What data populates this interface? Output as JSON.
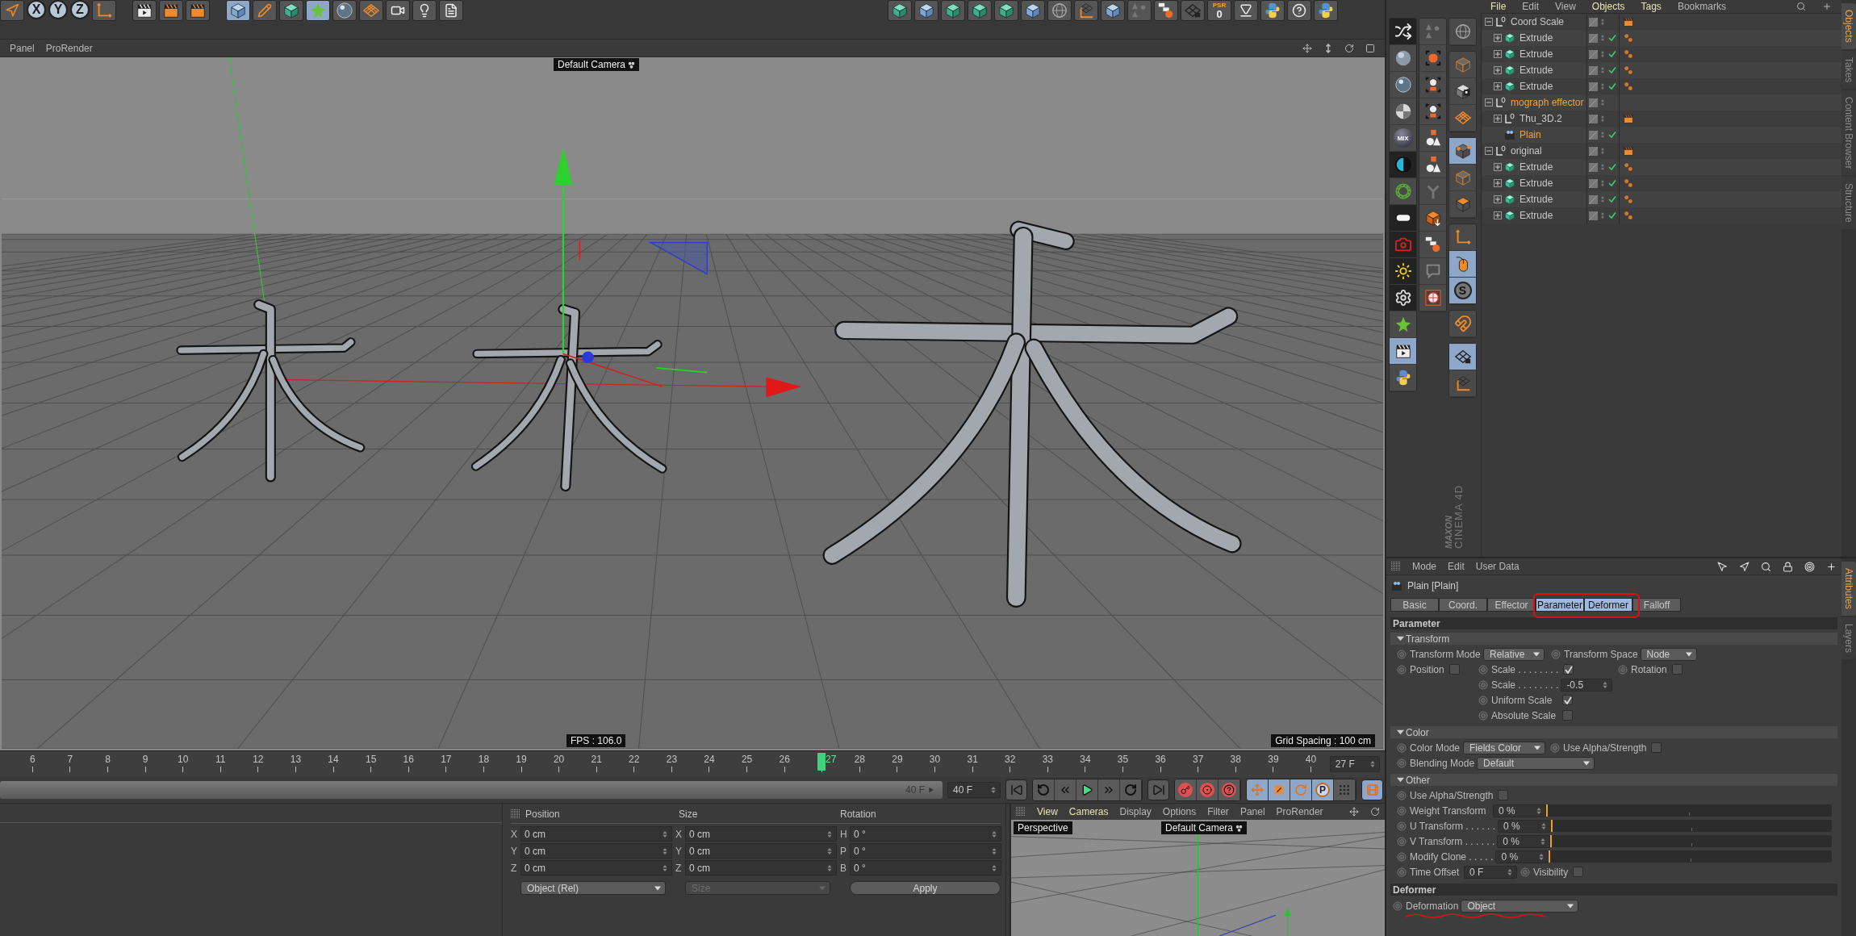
{
  "toolbar": {
    "axis_buttons": [
      {
        "label": "X",
        "selected": true
      },
      {
        "label": "Y",
        "selected": true
      },
      {
        "label": "Z",
        "selected": true
      }
    ],
    "psr_label": "PSR",
    "psr_value": "0"
  },
  "viewport": {
    "menu": [
      "Panel",
      "ProRender"
    ],
    "camera_label": "Default Camera",
    "fps": "FPS : 106.0",
    "grid_spacing": "Grid Spacing : 100 cm"
  },
  "timeline": {
    "ticks": [
      {
        "label": "6",
        "selected": false
      },
      {
        "label": "7",
        "selected": false
      },
      {
        "label": "8",
        "selected": false
      },
      {
        "label": "9",
        "selected": false
      },
      {
        "label": "10",
        "selected": false
      },
      {
        "label": "11",
        "selected": false
      },
      {
        "label": "12",
        "selected": false
      },
      {
        "label": "13",
        "selected": false
      },
      {
        "label": "14",
        "selected": false
      },
      {
        "label": "15",
        "selected": false
      },
      {
        "label": "16",
        "selected": false
      },
      {
        "label": "17",
        "selected": false
      },
      {
        "label": "18",
        "selected": false
      },
      {
        "label": "19",
        "selected": false
      },
      {
        "label": "20",
        "selected": false
      },
      {
        "label": "21",
        "selected": false
      },
      {
        "label": "22",
        "selected": false
      },
      {
        "label": "23",
        "selected": false
      },
      {
        "label": "24",
        "selected": false
      },
      {
        "label": "25",
        "selected": false
      },
      {
        "label": "26",
        "selected": false
      },
      {
        "label": "27",
        "selected": true
      },
      {
        "label": "28",
        "selected": false
      },
      {
        "label": "29",
        "selected": false
      },
      {
        "label": "30",
        "selected": false
      },
      {
        "label": "31",
        "selected": false
      },
      {
        "label": "32",
        "selected": false
      },
      {
        "label": "33",
        "selected": false
      },
      {
        "label": "34",
        "selected": false
      },
      {
        "label": "35",
        "selected": false
      },
      {
        "label": "36",
        "selected": false
      },
      {
        "label": "37",
        "selected": false
      },
      {
        "label": "38",
        "selected": false
      },
      {
        "label": "39",
        "selected": false
      },
      {
        "label": "40",
        "selected": false
      }
    ],
    "current_field": "27 F",
    "range": {
      "end_label": "40 F",
      "level": 1
    },
    "end_field": "40 F",
    "param_label": "P"
  },
  "coordinates": {
    "headers": [
      "Position",
      "Size",
      "Rotation"
    ],
    "rows": [
      {
        "pos_axis": "X",
        "pos": "0 cm",
        "size_axis": "X",
        "size": "0 cm",
        "rot_axis": "H",
        "rot": "0 °"
      },
      {
        "pos_axis": "Y",
        "pos": "0 cm",
        "size_axis": "Y",
        "size": "0 cm",
        "rot_axis": "P",
        "rot": "0 °"
      },
      {
        "pos_axis": "Z",
        "pos": "0 cm",
        "size_axis": "Z",
        "size": "0 cm",
        "rot_axis": "B",
        "rot": "0 °"
      }
    ],
    "mode_dropdown": "Object (Rel)",
    "size_dropdown": {
      "value": "Size",
      "disabled": true
    },
    "apply_button": "Apply"
  },
  "mini_viewport": {
    "menu": [
      {
        "label": "View",
        "highlighted": true
      },
      {
        "label": "Cameras",
        "highlighted": true
      },
      {
        "label": "Display",
        "highlighted": false
      },
      {
        "label": "Options",
        "highlighted": false
      },
      {
        "label": "Filter",
        "highlighted": false
      },
      {
        "label": "Panel",
        "highlighted": false
      },
      {
        "label": "ProRender",
        "highlighted": false
      }
    ],
    "projection_label": "Perspective",
    "camera_label": "Default Camera"
  },
  "palette": {
    "mix_label": "MIX",
    "snap_label": "S",
    "logo_brand": "MAXON",
    "logo_product": "CINEMA 4D"
  },
  "object_manager": {
    "menu": [
      "File",
      "Edit",
      "View",
      "Objects",
      "Tags",
      "Bookmarks"
    ],
    "tree": [
      {
        "name": "Coord Scale",
        "kind": "null",
        "selected": false,
        "expanded": true,
        "tagged": true,
        "children": [
          {
            "name": "Extrude",
            "kind": "extrude",
            "selected": false,
            "expanded": false,
            "enabled": true,
            "tagged": true
          },
          {
            "name": "Extrude",
            "kind": "extrude",
            "selected": false,
            "expanded": false,
            "enabled": true,
            "tagged": true
          },
          {
            "name": "Extrude",
            "kind": "extrude",
            "selected": false,
            "expanded": false,
            "enabled": true,
            "tagged": true
          },
          {
            "name": "Extrude",
            "kind": "extrude",
            "selected": false,
            "expanded": false,
            "enabled": true,
            "tagged": true
          }
        ]
      },
      {
        "name": "mograph effector",
        "kind": "null",
        "selected": true,
        "expanded": true,
        "tagged": false,
        "children": [
          {
            "name": "Thu_3D.2",
            "kind": "null",
            "selected": false,
            "expanded": false,
            "tagged": true
          },
          {
            "name": "Plain",
            "kind": "effector",
            "selected": true,
            "enabled": true,
            "tagged": false
          }
        ]
      },
      {
        "name": "original",
        "kind": "null",
        "selected": false,
        "expanded": true,
        "tagged": true,
        "children": [
          {
            "name": "Extrude",
            "kind": "extrude",
            "selected": false,
            "expanded": false,
            "enabled": true,
            "tagged": true
          },
          {
            "name": "Extrude",
            "kind": "extrude",
            "selected": false,
            "expanded": false,
            "enabled": true,
            "tagged": true
          },
          {
            "name": "Extrude",
            "kind": "extrude",
            "selected": false,
            "expanded": false,
            "enabled": true,
            "tagged": true
          },
          {
            "name": "Extrude",
            "kind": "extrude",
            "selected": false,
            "expanded": false,
            "enabled": true,
            "tagged": true
          }
        ]
      }
    ]
  },
  "top_side_tabs": [
    {
      "label": "Objects",
      "selected": true
    },
    {
      "label": "Takes",
      "selected": false
    },
    {
      "label": "Content Browser",
      "selected": false
    },
    {
      "label": "Structure",
      "selected": false
    }
  ],
  "bottom_side_tabs": [
    {
      "label": "Attributes",
      "selected": true
    },
    {
      "label": "Layers",
      "selected": false
    }
  ],
  "attributes": {
    "menu": [
      "Mode",
      "Edit",
      "User Data"
    ],
    "object_title": "Plain [Plain]",
    "tabs": [
      {
        "label": "Basic",
        "selected": false
      },
      {
        "label": "Coord.",
        "selected": false
      },
      {
        "label": "Effector",
        "selected": false
      },
      {
        "label": "Parameter",
        "selected": true
      },
      {
        "label": "Deformer",
        "selected": true
      },
      {
        "label": "Falloff",
        "selected": false
      }
    ],
    "section_title": "Parameter",
    "transform": {
      "title": "Transform",
      "expanded": true,
      "mode": {
        "label": "Transform Mode",
        "value": "Relative"
      },
      "space": {
        "label": "Transform Space",
        "value": "Node"
      },
      "position": {
        "label": "Position",
        "checked": false
      },
      "scale_toggle": {
        "label": "Scale . . . . . . . .",
        "checked": true
      },
      "rotation": {
        "label": "Rotation",
        "checked": false
      },
      "scale_value": {
        "label": "Scale . . . . . . . .",
        "value": "-0.5"
      },
      "uniform": {
        "label": "Uniform Scale",
        "checked": true
      },
      "absolute": {
        "label": "Absolute Scale",
        "checked": false
      }
    },
    "color": {
      "title": "Color",
      "expanded": true,
      "mode": {
        "label": "Color Mode",
        "value": "Fields Color"
      },
      "alpha": {
        "label": "Use Alpha/Strength",
        "checked": false
      },
      "blending": {
        "label": "Blending Mode",
        "value": "Default"
      }
    },
    "other": {
      "title": "Other",
      "expanded": true,
      "alpha": {
        "label": "Use Alpha/Strength",
        "checked": false
      },
      "sliders": [
        {
          "label": "Weight Transform",
          "value": "0 %",
          "level": 0
        },
        {
          "label": "U Transform . . . . . .",
          "value": "0 %",
          "level": 0
        },
        {
          "label": "V Transform . . . . . .",
          "value": "0 %",
          "level": 0
        },
        {
          "label": "Modify Clone . . . . .",
          "value": "0 %",
          "level": 0
        }
      ],
      "time_offset": {
        "label": "Time Offset",
        "value": "0 F"
      },
      "visibility": {
        "label": "Visibility",
        "checked": false
      }
    },
    "deformer": {
      "title": "Deformer",
      "label": "Deformation",
      "value": "Object"
    }
  }
}
